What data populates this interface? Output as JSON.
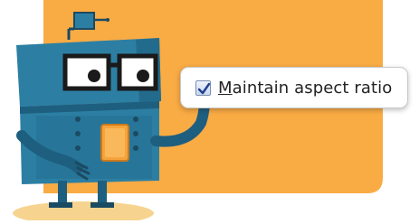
{
  "option": {
    "label_first": "M",
    "label_rest": "aintain aspect ratio",
    "checked": true
  },
  "colors": {
    "panel": "#f9ab44",
    "robot_body": "#2c7fa3",
    "robot_dark": "#1e5f80",
    "chip": "#f7a33b",
    "ground": "#f6d48f"
  },
  "icons": [
    "robot-mascot",
    "checkmark-icon",
    "antenna-icon"
  ]
}
